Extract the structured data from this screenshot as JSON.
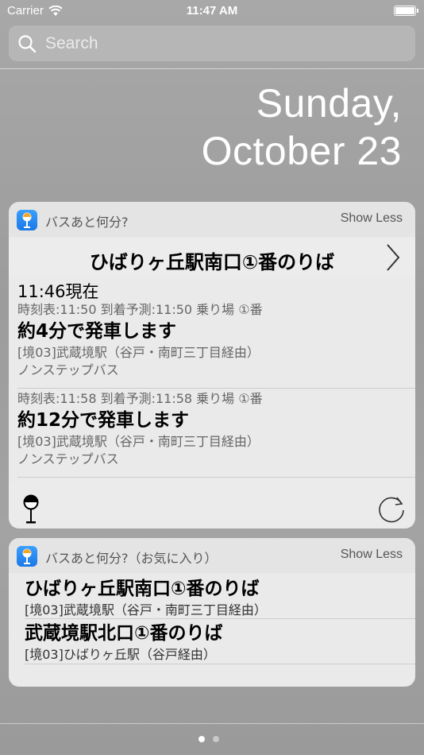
{
  "status_bar": {
    "carrier": "Carrier",
    "time": "11:47 AM",
    "battery": 100
  },
  "search": {
    "placeholder": "Search"
  },
  "date": {
    "weekday": "Sunday,",
    "date": "October 23"
  },
  "widget1": {
    "app_name": "バスあと何分?",
    "toggle_label": "Show Less",
    "stop_name": "ひばりヶ丘駅南口①番のりば",
    "now_time": "11:46現在",
    "departures": [
      {
        "schedule": "時刻表:11:50 到着予測:11:50 乗り場 ①番",
        "eta": "約4分で発車します",
        "route": "[境03]武蔵境駅（谷戸・南町三丁目経由）",
        "bus_type": "ノンステップバス"
      },
      {
        "schedule": "時刻表:11:58 到着予測:11:58 乗り場 ①番",
        "eta": "約12分で発車します",
        "route": "[境03]武蔵境駅（谷戸・南町三丁目経由）",
        "bus_type": "ノンステップバス"
      }
    ]
  },
  "widget2": {
    "app_name": "バスあと何分?（お気に入り）",
    "toggle_label": "Show Less",
    "favorites": [
      {
        "name": "ひばりヶ丘駅南口①番のりば",
        "route": "[境03]武蔵境駅（谷戸・南町三丁目経由）"
      },
      {
        "name": "武蔵境駅北口①番のりば",
        "route": "[境03]ひばりヶ丘駅（谷戸経由）"
      }
    ]
  },
  "page_indicator": {
    "count": 2,
    "active": 1
  },
  "colors": {
    "app_icon_blue": "#1b78e6",
    "text_secondary": "#666666"
  }
}
